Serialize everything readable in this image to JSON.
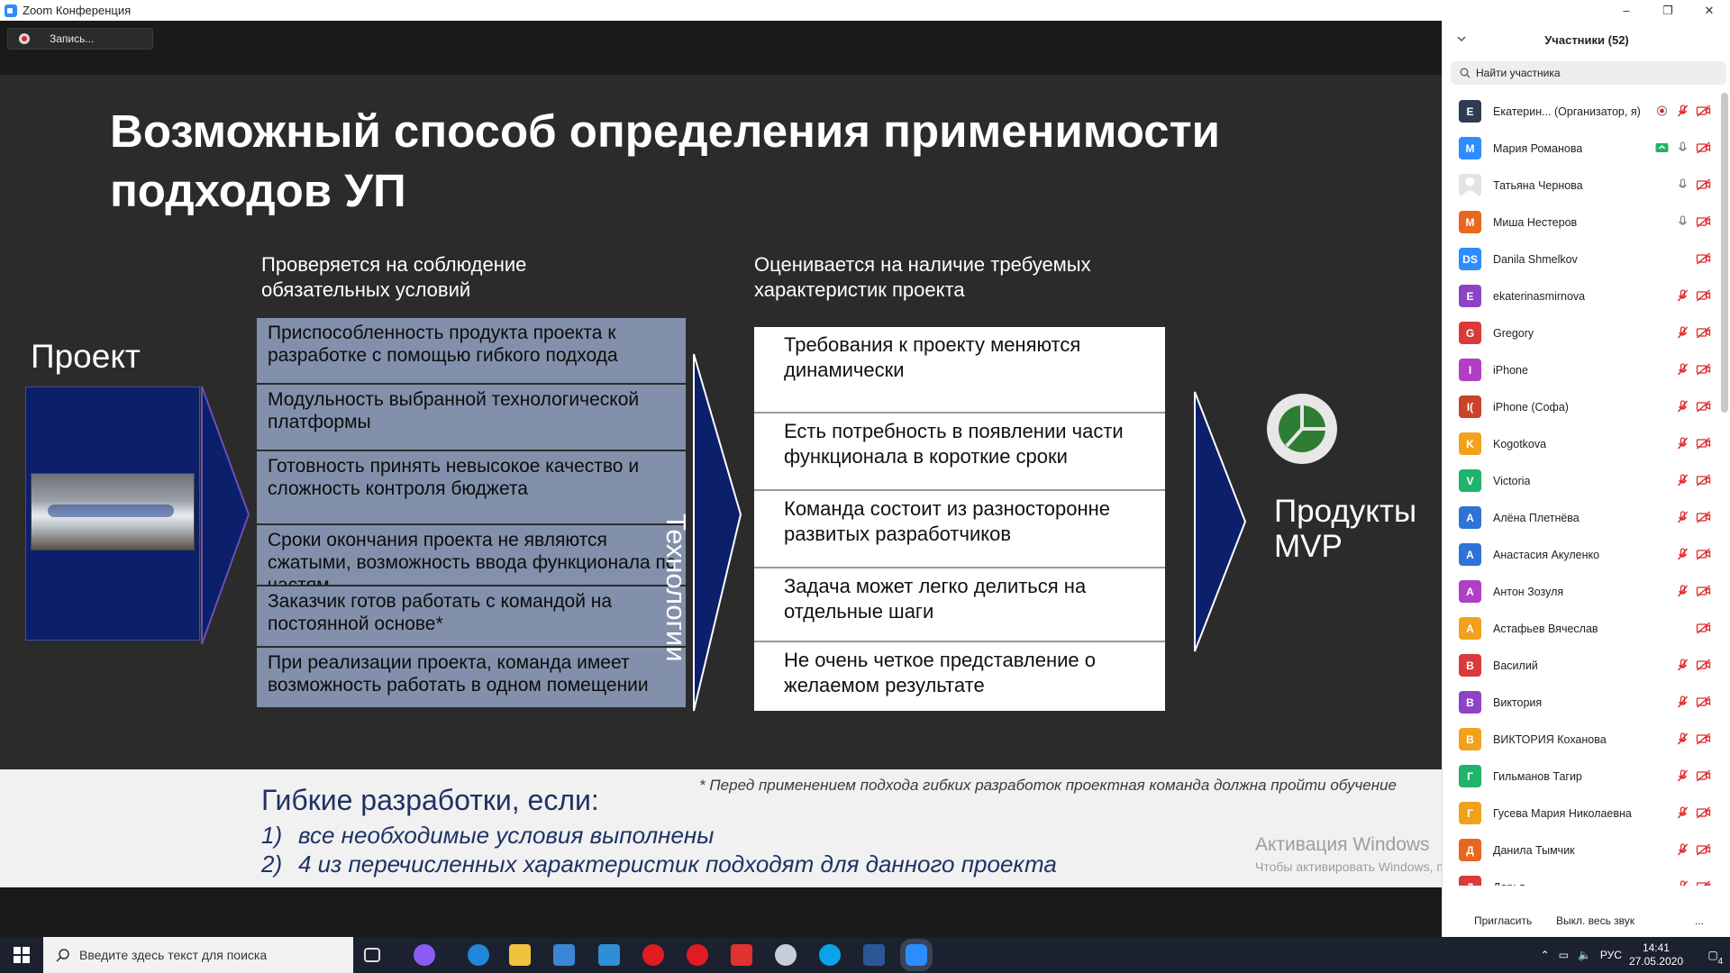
{
  "window": {
    "title": "Zoom Конференция",
    "minimize": "–",
    "restore": "❐",
    "close": "✕"
  },
  "recording": {
    "label": "Запись..."
  },
  "slide": {
    "title_line1": "Возможный способ определения применимости",
    "title_line2": "подходов УП",
    "left_heading_1": "Проверяется на соблюдение",
    "left_heading_2": "обязательных условий",
    "right_heading_1": "Оценивается на наличие требуемых",
    "right_heading_2": "характеристик проекта",
    "project_label": "Проект",
    "conditions": [
      "Приспособленность продукта проекта к разработке с помощью гибкого подхода",
      "Модульность выбранной технологической платформы",
      "Готовность принять невысокое качество и сложность контроля бюджета",
      "Сроки окончания проекта не являются сжатыми, возможность ввода функционала по частям",
      "Заказчик готов работать с командой на постоянной основе*",
      "При реализации проекта, команда имеет возможность работать в одном помещении"
    ],
    "tech_label": "Технологии",
    "characteristics": [
      "Требования к проекту меняются динамически",
      "Есть потребность в появлении части функционала в короткие сроки",
      "Команда состоит из разносторонне развитых разработчиков",
      "Задача может легко делиться на отдельные шаги",
      "Не очень четкое представление о желаемом результате"
    ],
    "mvp_line1": "Продукты",
    "mvp_line2": "MVP",
    "footnote": "* Перед применением подхода гибких разработок проектная команда должна пройти обучение",
    "agile_title": "Гибкие разработки, если:",
    "agile_items": [
      {
        "num": "1)",
        "text": "все необходимые условия выполнены"
      },
      {
        "num": "2)",
        "text": "4 из перечисленных характеристик подходят для данного проекта"
      }
    ],
    "watermark": "Активация Windows",
    "watermark_sub": "Чтобы активировать Windows, перейдите в раздел \"Параметры\"."
  },
  "participants": {
    "title": "Участники (52)",
    "search_placeholder": "Найти участника",
    "list": [
      {
        "initial": "Е",
        "name": "Екатерин... (Организатор, я)",
        "color": "#2f3b52",
        "rec": true,
        "mic": "muted",
        "video": "off"
      },
      {
        "initial": "М",
        "name": "Мария Романова",
        "color": "#2d8cff",
        "share": true,
        "mic": "on",
        "video": "off"
      },
      {
        "initial": "",
        "name": "Татьяна Чернова",
        "color": "#e3e3e3",
        "photo": true,
        "mic": "on",
        "video": "off"
      },
      {
        "initial": "М",
        "name": "Миша Нестеров",
        "color": "#e8671e",
        "mic": "on",
        "video": "off"
      },
      {
        "initial": "DS",
        "name": "Danila Shmelkov",
        "color": "#2d8cff",
        "mic": "",
        "video": "off"
      },
      {
        "initial": "E",
        "name": "ekaterinasmirnova",
        "color": "#8d44c4",
        "mic": "muted",
        "video": "off"
      },
      {
        "initial": "G",
        "name": "Gregory",
        "color": "#d93a3a",
        "mic": "muted",
        "video": "off"
      },
      {
        "initial": "I",
        "name": "iPhone",
        "color": "#b03fc4",
        "mic": "muted",
        "video": "off"
      },
      {
        "initial": "I(",
        "name": "iPhone (Софа)",
        "color": "#c8432a",
        "mic": "muted",
        "video": "off"
      },
      {
        "initial": "K",
        "name": "Kogotkova",
        "color": "#f2a11c",
        "mic": "muted",
        "video": "off"
      },
      {
        "initial": "V",
        "name": "Victoria",
        "color": "#1fb36b",
        "mic": "muted",
        "video": "off"
      },
      {
        "initial": "А",
        "name": "Алёна Плетнёва",
        "color": "#2d73d8",
        "mic": "muted",
        "video": "off"
      },
      {
        "initial": "А",
        "name": "Анастасия Акуленко",
        "color": "#2d73d8",
        "mic": "muted",
        "video": "off"
      },
      {
        "initial": "А",
        "name": "Антон Зозуля",
        "color": "#b03fc4",
        "mic": "muted",
        "video": "off"
      },
      {
        "initial": "А",
        "name": "Астафьев Вячеслав",
        "color": "#f2a11c",
        "mic": "",
        "video": "off"
      },
      {
        "initial": "В",
        "name": "Василий",
        "color": "#d93a3a",
        "mic": "muted",
        "video": "off"
      },
      {
        "initial": "В",
        "name": "Виктория",
        "color": "#8d44c4",
        "mic": "muted",
        "video": "off"
      },
      {
        "initial": "В",
        "name": "ВИКТОРИЯ Коханова",
        "color": "#f2a11c",
        "mic": "muted",
        "video": "off"
      },
      {
        "initial": "Г",
        "name": "Гильманов Тагир",
        "color": "#1fb36b",
        "mic": "muted",
        "video": "off"
      },
      {
        "initial": "Г",
        "name": "Гусева Мария Николаевна",
        "color": "#f2a11c",
        "mic": "muted",
        "video": "off"
      },
      {
        "initial": "Д",
        "name": "Данила Тымчик",
        "color": "#e8671e",
        "mic": "muted",
        "video": "off"
      },
      {
        "initial": "Д",
        "name": "Дарья",
        "color": "#d93a3a",
        "mic": "muted",
        "video": "off"
      }
    ],
    "invite": "Пригласить",
    "mute_all": "Выкл. весь звук",
    "more": "..."
  },
  "taskbar": {
    "search_placeholder": "Введите здесь текст для поиска",
    "lang": "РУС",
    "time": "14:41",
    "date": "27.05.2020",
    "notifications": "4"
  },
  "colors": {
    "condition_bg": "#8290ab",
    "project_bg": "#0b1f6b",
    "arrow": "#0b1f6b",
    "muted_red": "#e02828",
    "accent_blue": "#2d8cff"
  }
}
